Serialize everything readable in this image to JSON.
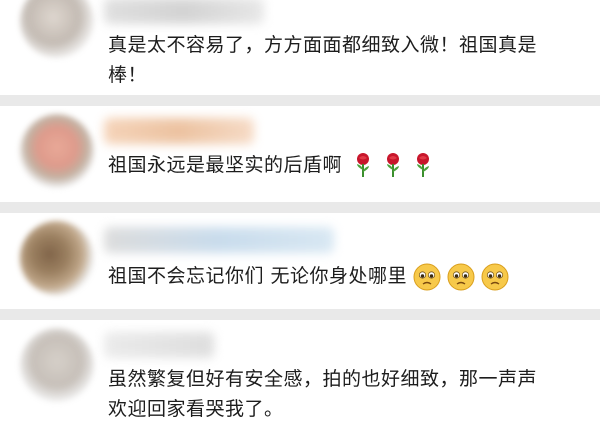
{
  "comments": [
    {
      "text": "真是太不容易了，方方面面都细致入微！祖国真是棒！",
      "line1": "真是太不容易了，方方面面都细致入微！祖国真是",
      "line2": "棒！"
    },
    {
      "text": "祖国永远是最坚实的后盾啊",
      "emojis": [
        "rose-icon",
        "rose-icon",
        "rose-icon"
      ]
    },
    {
      "text": "祖国不会忘记你们  无论你身处哪里",
      "emojis": [
        "crying-face-icon",
        "crying-face-icon",
        "crying-face-icon"
      ]
    },
    {
      "text": "虽然繁复但好有安全感，拍的也好细致，那一声声欢迎回家看哭我了。",
      "line1": "虽然繁复但好有安全感，拍的也好细致，那一声声",
      "line2": "欢迎回家看哭我了。"
    }
  ],
  "colors": {
    "background": "#e9e9e9",
    "card": "#ffffff",
    "text": "#1d1d1d"
  }
}
